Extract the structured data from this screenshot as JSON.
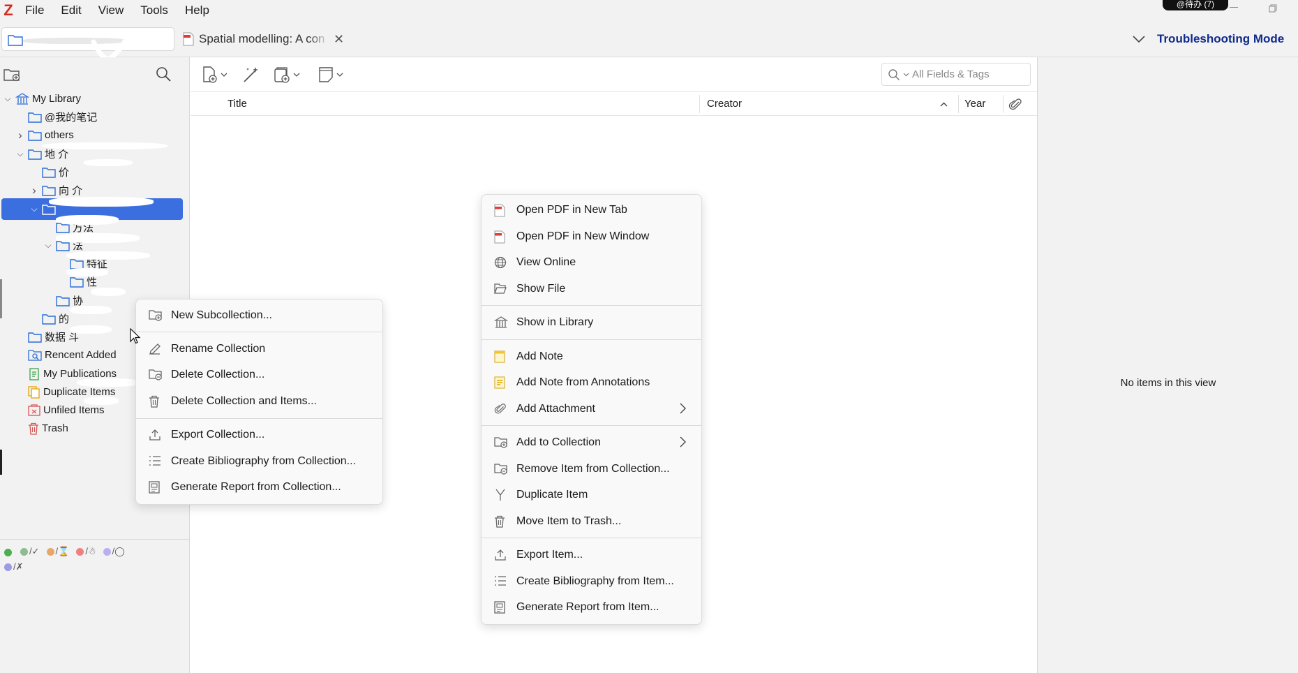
{
  "menubar": {
    "logo": "Z",
    "items": [
      "File",
      "Edit",
      "View",
      "Tools",
      "Help"
    ],
    "system_badge": "@待办 (7)"
  },
  "tabs": {
    "library_tab": "",
    "pdf_tab_title": "Spatial modelling: A con",
    "troubleshooting_label": "Troubleshooting Mode"
  },
  "sidebar": {
    "tree": [
      {
        "label": "My Library",
        "icon": "library-icon",
        "expanded": true
      },
      {
        "label": "@我的笔记",
        "icon": "folder-icon"
      },
      {
        "label": "others",
        "icon": "folder-icon",
        "collapsed": true
      },
      {
        "label": "地 介",
        "icon": "folder-icon",
        "expanded": true
      },
      {
        "label": "价",
        "icon": "folder-icon"
      },
      {
        "label": "向 介",
        "icon": "folder-icon",
        "collapsed": true
      },
      {
        "label": "",
        "icon": "folder-icon",
        "expanded": true,
        "selected": true
      },
      {
        "label": "方法",
        "icon": "folder-icon"
      },
      {
        "label": "法",
        "icon": "folder-icon",
        "expanded": true
      },
      {
        "label": "特征",
        "icon": "folder-icon"
      },
      {
        "label": "性",
        "icon": "folder-icon"
      },
      {
        "label": "协",
        "icon": "folder-icon"
      },
      {
        "label": "的",
        "icon": "folder-icon"
      },
      {
        "label": "数据 斗",
        "icon": "folder-icon"
      },
      {
        "label": "Rencent Added",
        "icon": "saved-search-icon"
      },
      {
        "label": "My Publications",
        "icon": "publications-icon"
      },
      {
        "label": "Duplicate Items",
        "icon": "duplicate-icon"
      },
      {
        "label": "Unfiled Items",
        "icon": "unfiled-icon"
      },
      {
        "label": "Trash",
        "icon": "trash-icon"
      }
    ],
    "tags": [
      {
        "color": "#4caf50",
        "label": ""
      },
      {
        "color": "#8fbc8f",
        "label": "/✓"
      },
      {
        "color": "#e8a865",
        "label": "/⌛"
      },
      {
        "color": "#f08080",
        "label": "/☃"
      },
      {
        "color": "#b8b0f0",
        "label": "/◯"
      },
      {
        "color": "#9b9be8",
        "label": "/✗"
      }
    ]
  },
  "main": {
    "search_placeholder": "All Fields & Tags",
    "columns": {
      "title": "Title",
      "creator": "Creator",
      "year": "Year"
    }
  },
  "right_pane": {
    "empty_message": "No items in this view"
  },
  "collection_menu": {
    "groups": [
      [
        {
          "label": "New Subcollection...",
          "icon": "new-subcollection-icon"
        }
      ],
      [
        {
          "label": "Rename Collection",
          "icon": "rename-icon"
        },
        {
          "label": "Delete Collection...",
          "icon": "delete-collection-icon"
        },
        {
          "label": "Delete Collection and Items...",
          "icon": "trash-icon"
        }
      ],
      [
        {
          "label": "Export Collection...",
          "icon": "export-icon"
        },
        {
          "label": "Create Bibliography from Collection...",
          "icon": "bibliography-icon"
        },
        {
          "label": "Generate Report from Collection...",
          "icon": "report-icon"
        }
      ]
    ]
  },
  "item_menu": {
    "groups": [
      [
        {
          "label": "Open PDF in New Tab",
          "icon": "pdf-icon"
        },
        {
          "label": "Open PDF in New Window",
          "icon": "pdf-icon"
        },
        {
          "label": "View Online",
          "icon": "globe-icon"
        },
        {
          "label": "Show File",
          "icon": "folder-open-icon"
        }
      ],
      [
        {
          "label": "Show in Library",
          "icon": "library-icon"
        }
      ],
      [
        {
          "label": "Add Note",
          "icon": "note-icon"
        },
        {
          "label": "Add Note from Annotations",
          "icon": "annotation-note-icon"
        },
        {
          "label": "Add Attachment",
          "icon": "paperclip-icon",
          "submenu": true
        }
      ],
      [
        {
          "label": "Add to Collection",
          "icon": "add-to-collection-icon",
          "submenu": true
        },
        {
          "label": "Remove Item from Collection...",
          "icon": "remove-from-collection-icon"
        },
        {
          "label": "Duplicate Item",
          "icon": "duplicate-item-icon"
        },
        {
          "label": "Move Item to Trash...",
          "icon": "trash-icon"
        }
      ],
      [
        {
          "label": "Export Item...",
          "icon": "export-icon"
        },
        {
          "label": "Create Bibliography from Item...",
          "icon": "bibliography-icon"
        },
        {
          "label": "Generate Report from Item...",
          "icon": "report-icon"
        }
      ]
    ]
  }
}
